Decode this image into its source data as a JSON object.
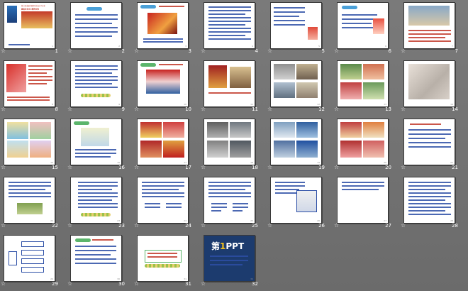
{
  "slides": [
    {
      "num": "1",
      "title": "建设社会主义精神文明",
      "subtitle": "第十课  发展中国特色社会主义文化"
    },
    {
      "num": "2"
    },
    {
      "num": "3"
    },
    {
      "num": "4"
    },
    {
      "num": "5"
    },
    {
      "num": "6"
    },
    {
      "num": "7"
    },
    {
      "num": "8"
    },
    {
      "num": "9"
    },
    {
      "num": "10"
    },
    {
      "num": "11"
    },
    {
      "num": "12"
    },
    {
      "num": "13"
    },
    {
      "num": "14"
    },
    {
      "num": "15"
    },
    {
      "num": "16"
    },
    {
      "num": "17"
    },
    {
      "num": "18"
    },
    {
      "num": "19"
    },
    {
      "num": "20"
    },
    {
      "num": "21"
    },
    {
      "num": "22"
    },
    {
      "num": "23"
    },
    {
      "num": "24"
    },
    {
      "num": "25"
    },
    {
      "num": "26"
    },
    {
      "num": "27"
    },
    {
      "num": "28"
    },
    {
      "num": "29"
    },
    {
      "num": "30"
    },
    {
      "num": "31"
    },
    {
      "num": "32",
      "logo_main": "第1PPT",
      "logo_accent": "1"
    }
  ],
  "star_glyph": "☆",
  "colors": {
    "background": "#6f6f6f",
    "text_blue": "#2d4fa6",
    "text_red": "#c23a2a"
  }
}
